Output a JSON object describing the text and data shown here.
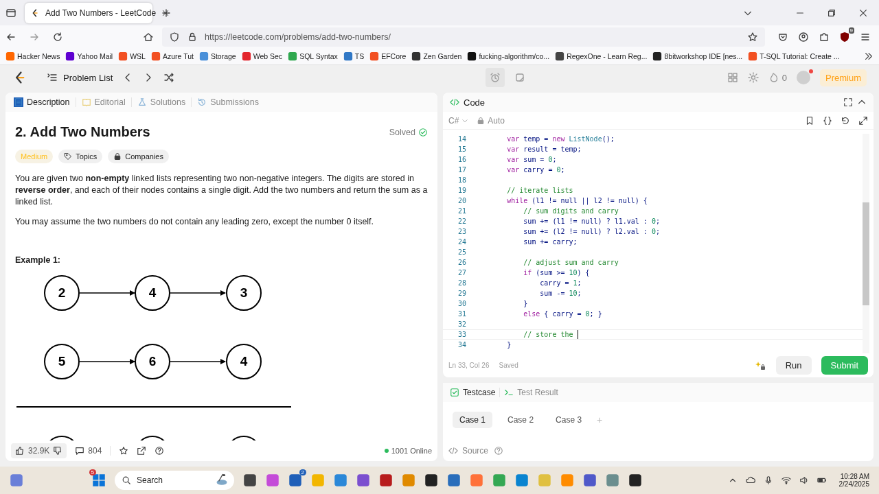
{
  "browser": {
    "tabs": [
      {
        "title": "Add Two Numbers - LeetCode",
        "selected": true
      }
    ],
    "url": "https://leetcode.com/problems/add-two-numbers/",
    "extension_badge": "9",
    "bookmarks": [
      "Hacker News",
      "Yahoo Mail",
      "WSL",
      "Azure Tut",
      "Storage",
      "Web Sec",
      "SQL Syntax",
      "TS",
      "EFCore",
      "Zen Garden",
      "fucking-algorithm/co...",
      "RegexOne - Learn Reg...",
      "8bitworkshop IDE [nes...",
      "T-SQL Tutorial: Create ..."
    ]
  },
  "nav": {
    "problem_list": "Problem List",
    "streak": "0",
    "premium": "Premium"
  },
  "description_panel": {
    "tabs": [
      {
        "label": "Description",
        "selected": true
      },
      {
        "label": "Editorial",
        "selected": false
      },
      {
        "label": "Solutions",
        "selected": false
      },
      {
        "label": "Submissions",
        "selected": false
      }
    ],
    "title": "2. Add Two Numbers",
    "status": "Solved",
    "difficulty": "Medium",
    "topics": "Topics",
    "companies": "Companies",
    "paragraphs": [
      "You are given two **non-empty** linked lists representing two non-negative integers. The digits are stored in **reverse order**, and each of their nodes contains a single digit. Add the two numbers and return the sum as a linked list.",
      "You may assume the two numbers do not contain any leading zero, except the number 0 itself."
    ],
    "example": {
      "title": "Example 1:",
      "lists": [
        {
          "nodes": [
            "2",
            "4",
            "3"
          ]
        },
        {
          "nodes": [
            "5",
            "6",
            "4"
          ]
        }
      ]
    },
    "likes": "32.9K",
    "comments": "804",
    "online": "1001 Online"
  },
  "code_panel": {
    "title": "Code",
    "language": "C#",
    "mode": "Auto",
    "lines": [
      {
        "number": "14",
        "tokens": [
          {
            "kind": "keyword",
            "text": "        var"
          },
          {
            "kind": "plain",
            "text": " temp = "
          },
          {
            "kind": "keyword",
            "text": "new"
          },
          {
            "kind": "type",
            "text": " ListNode"
          },
          {
            "kind": "plain",
            "text": "();"
          }
        ]
      },
      {
        "number": "15",
        "tokens": [
          {
            "kind": "keyword",
            "text": "        var"
          },
          {
            "kind": "plain",
            "text": " result = temp;"
          }
        ]
      },
      {
        "number": "16",
        "tokens": [
          {
            "kind": "keyword",
            "text": "        var"
          },
          {
            "kind": "plain",
            "text": " sum = "
          },
          {
            "kind": "number",
            "text": "0"
          },
          {
            "kind": "plain",
            "text": ";"
          }
        ]
      },
      {
        "number": "17",
        "tokens": [
          {
            "kind": "keyword",
            "text": "        var"
          },
          {
            "kind": "plain",
            "text": " carry = "
          },
          {
            "kind": "number",
            "text": "0"
          },
          {
            "kind": "plain",
            "text": ";"
          }
        ]
      },
      {
        "number": "18"
      },
      {
        "number": "19",
        "tokens": [
          {
            "kind": "comment",
            "text": "        // iterate lists"
          }
        ]
      },
      {
        "number": "20",
        "tokens": [
          {
            "kind": "keyword",
            "text": "        while"
          },
          {
            "kind": "plain",
            "text": " (l1 != null || l2 != null) {"
          }
        ]
      },
      {
        "number": "21",
        "tokens": [
          {
            "kind": "comment",
            "text": "            // sum digits and carry"
          }
        ]
      },
      {
        "number": "22",
        "tokens": [
          {
            "kind": "plain",
            "text": "            sum += (l1 != null) ? l1.val : "
          },
          {
            "kind": "number",
            "text": "0"
          },
          {
            "kind": "plain",
            "text": ";"
          }
        ]
      },
      {
        "number": "23",
        "tokens": [
          {
            "kind": "plain",
            "text": "            sum += (l2 != null) ? l2.val : "
          },
          {
            "kind": "number",
            "text": "0"
          },
          {
            "kind": "plain",
            "text": ";"
          }
        ]
      },
      {
        "number": "24",
        "tokens": [
          {
            "kind": "plain",
            "text": "            sum += carry;"
          }
        ]
      },
      {
        "number": "25"
      },
      {
        "number": "26",
        "tokens": [
          {
            "kind": "comment",
            "text": "            // adjust sum and carry"
          }
        ]
      },
      {
        "number": "27",
        "tokens": [
          {
            "kind": "keyword",
            "text": "            if"
          },
          {
            "kind": "plain",
            "text": " (sum >= "
          },
          {
            "kind": "number",
            "text": "10"
          },
          {
            "kind": "plain",
            "text": ") {"
          }
        ]
      },
      {
        "number": "28",
        "tokens": [
          {
            "kind": "plain",
            "text": "                carry = "
          },
          {
            "kind": "number",
            "text": "1"
          },
          {
            "kind": "plain",
            "text": ";"
          }
        ]
      },
      {
        "number": "29",
        "tokens": [
          {
            "kind": "plain",
            "text": "                sum -= "
          },
          {
            "kind": "number",
            "text": "10"
          },
          {
            "kind": "plain",
            "text": ";"
          }
        ]
      },
      {
        "number": "30",
        "tokens": [
          {
            "kind": "plain",
            "text": "            }"
          }
        ]
      },
      {
        "number": "31",
        "tokens": [
          {
            "kind": "keyword",
            "text": "            else"
          },
          {
            "kind": "plain",
            "text": " { carry = "
          },
          {
            "kind": "number",
            "text": "0"
          },
          {
            "kind": "plain",
            "text": "; }"
          }
        ]
      },
      {
        "number": "32"
      },
      {
        "number": "33",
        "active": true,
        "tokens": [
          {
            "kind": "comment",
            "text": "            // store the "
          }
        ]
      },
      {
        "number": "34",
        "tokens": [
          {
            "kind": "plain",
            "text": "        }"
          }
        ]
      }
    ],
    "cursor_position": "Ln 33, Col 26",
    "save_state": "Saved",
    "run": "Run",
    "submit": "Submit"
  },
  "test_panel": {
    "tabs": [
      {
        "label": "Testcase",
        "selected": true
      },
      {
        "label": "Test Result",
        "selected": false
      }
    ],
    "cases": [
      {
        "label": "Case 1",
        "selected": true
      },
      {
        "label": "Case 2",
        "selected": false
      },
      {
        "label": "Case 3",
        "selected": false
      }
    ],
    "add": "+",
    "source": "Source"
  },
  "taskbar": {
    "widget_badge": "5",
    "search": "Search",
    "app_badge": "2",
    "time": "10:28 AM",
    "date": "2/24/2025"
  }
}
